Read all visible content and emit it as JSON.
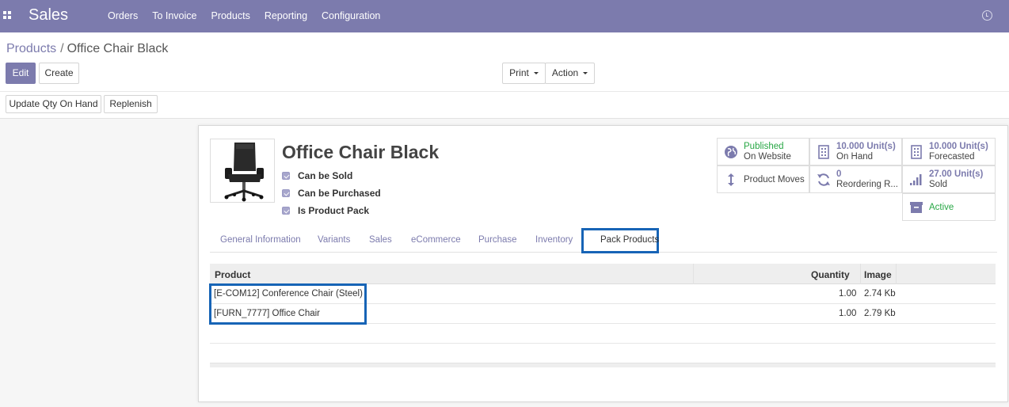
{
  "navbar": {
    "brand": "Sales",
    "menu": [
      "Orders",
      "To Invoice",
      "Products",
      "Reporting",
      "Configuration"
    ]
  },
  "breadcrumb": {
    "parent": "Products",
    "separator": "/",
    "current": "Office Chair Black"
  },
  "buttons": {
    "edit": "Edit",
    "create": "Create",
    "print": "Print",
    "action": "Action",
    "update_qty": "Update Qty On Hand",
    "replenish": "Replenish"
  },
  "product": {
    "name": "Office Chair Black",
    "flags": [
      {
        "label": "Can be Sold",
        "checked": true
      },
      {
        "label": "Can be Purchased",
        "checked": true
      },
      {
        "label": "Is Product Pack",
        "checked": true
      }
    ]
  },
  "smart_buttons": {
    "published": {
      "value": "Published",
      "label": "On Website"
    },
    "on_hand": {
      "value": "10.000 Unit(s)",
      "label": "On Hand"
    },
    "forecasted": {
      "value": "10.000 Unit(s)",
      "label": "Forecasted"
    },
    "moves": {
      "label": "Product Moves"
    },
    "reordering": {
      "value": "0",
      "label": "Reordering R..."
    },
    "sold": {
      "value": "27.00 Unit(s)",
      "label": "Sold"
    },
    "active": {
      "label": "Active"
    }
  },
  "tabs": {
    "items": [
      "General Information",
      "Variants",
      "Sales",
      "eCommerce",
      "Purchase",
      "Inventory"
    ],
    "active": "Pack Products"
  },
  "pack_table": {
    "headers": {
      "product": "Product",
      "quantity": "Quantity",
      "image": "Image"
    },
    "rows": [
      {
        "product": "[E-COM12] Conference Chair (Steel)",
        "quantity": "1.00",
        "image": "2.74 Kb"
      },
      {
        "product": "[FURN_7777] Office Chair",
        "quantity": "1.00",
        "image": "2.79 Kb"
      }
    ]
  },
  "colors": {
    "brand": "#7c7bad",
    "highlight": "#1764b6",
    "active_green": "#28a745"
  }
}
